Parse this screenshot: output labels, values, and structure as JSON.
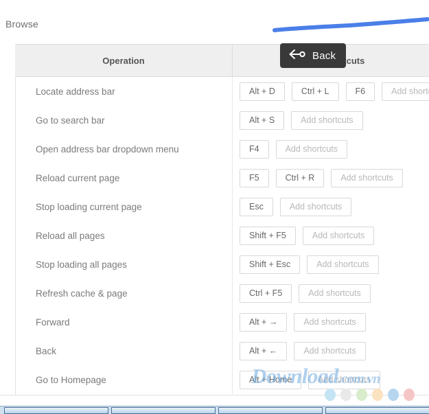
{
  "page": {
    "heading": "Browse"
  },
  "table": {
    "headers": {
      "operation": "Operation",
      "shortcuts": "Shortcuts"
    },
    "add_shortcuts_label": "Add shortcuts",
    "rows": [
      {
        "operation": "Locate address bar",
        "keys": [
          "Alt + D",
          "Ctrl + L",
          "F6"
        ],
        "add_slots": 1
      },
      {
        "operation": "Go to search bar",
        "keys": [
          "Alt + S"
        ],
        "add_slots": 1
      },
      {
        "operation": "Open address bar dropdown menu",
        "keys": [
          "F4"
        ],
        "add_slots": 1
      },
      {
        "operation": "Reload current page",
        "keys": [
          "F5",
          "Ctrl + R"
        ],
        "add_slots": 1
      },
      {
        "operation": "Stop loading current page",
        "keys": [
          "Esc"
        ],
        "add_slots": 1
      },
      {
        "operation": "Reload all pages",
        "keys": [
          "Shift + F5"
        ],
        "add_slots": 1
      },
      {
        "operation": "Stop loading all pages",
        "keys": [
          "Shift + Esc"
        ],
        "add_slots": 1
      },
      {
        "operation": "Refresh cache & page",
        "keys": [
          "Ctrl + F5"
        ],
        "add_slots": 1
      },
      {
        "operation": "Forward",
        "keys": [
          "Alt + →"
        ],
        "add_slots": 1
      },
      {
        "operation": "Back",
        "keys": [
          "Alt + ←"
        ],
        "add_slots": 1
      },
      {
        "operation": "Go to Homepage",
        "keys": [
          "Alt + Home"
        ],
        "add_slots": 1
      }
    ]
  },
  "tooltip": {
    "label": "Back",
    "icon": "back-arrow-icon",
    "background": "#393939",
    "text_color": "#ffffff"
  },
  "annotation": {
    "name": "blue-underline-stroke",
    "color": "#4a7fe8"
  },
  "dots": [
    {
      "name": "dot-blue-light",
      "color": "#c5e4f3"
    },
    {
      "name": "dot-gray",
      "color": "#e9e9e9"
    },
    {
      "name": "dot-green",
      "color": "#d8eccb"
    },
    {
      "name": "dot-orange",
      "color": "#fbe2c0"
    },
    {
      "name": "dot-blue",
      "color": "#b6d6ef"
    },
    {
      "name": "dot-pink",
      "color": "#f6c5c5"
    }
  ],
  "watermark": {
    "main": "Download",
    "tld": ".com.vn"
  }
}
